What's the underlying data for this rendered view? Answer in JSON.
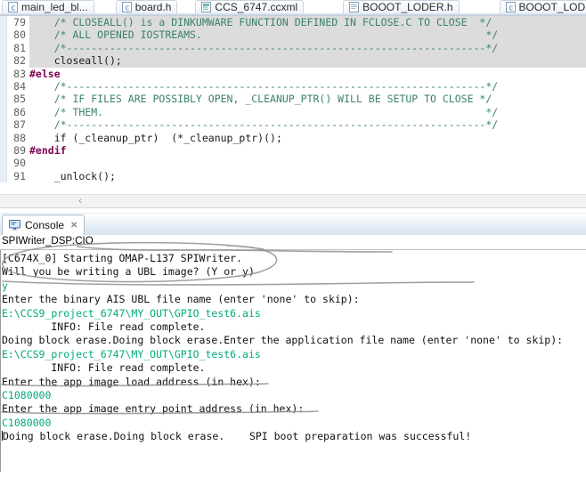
{
  "colors": {
    "comment_green": "#3C8269",
    "directive_maroon": "#7F0055",
    "console_input_green": "#00AA7D",
    "selection_gray": "#DCDCDC",
    "annotation_gray": "#8F8F8F"
  },
  "editor_tabs": [
    {
      "label": "main_led_bl...",
      "icon": "c-file-icon"
    },
    {
      "label": "board.h",
      "icon": "c-file-icon"
    },
    {
      "label": "CCS_6747.ccxml",
      "icon": "target-config-icon"
    },
    {
      "label": "BOOOT_LODER.h",
      "icon": "header-file-icon"
    },
    {
      "label": "BOOOT_LODER.c",
      "icon": "c-file-icon"
    }
  ],
  "icons": {
    "close": "✕",
    "scroll_left": "‹"
  },
  "editor": {
    "lines": [
      {
        "num": "79",
        "text": "    /* CLOSEALL() is a DINKUMWARE FUNCTION DEFINED IN FCLOSE.C TO CLOSE  */"
      },
      {
        "num": "80",
        "text": "    /* ALL OPENED IOSTREAMS.                                              */"
      },
      {
        "num": "81",
        "text": "    /*--------------------------------------------------------------------*/"
      },
      {
        "num": "82",
        "text": "    closeall();"
      },
      {
        "num": "83",
        "text": "#else"
      },
      {
        "num": "84",
        "text": "    /*--------------------------------------------------------------------*/"
      },
      {
        "num": "85",
        "text": "    /* IF FILES ARE POSSIBLY OPEN, _CLEANUP_PTR() WILL BE SETUP TO CLOSE */"
      },
      {
        "num": "86",
        "text": "    /* THEM.                                                              */"
      },
      {
        "num": "87",
        "text": "    /*--------------------------------------------------------------------*/"
      },
      {
        "num": "88",
        "text": "    if (_cleanup_ptr)  (*_cleanup_ptr)();"
      },
      {
        "num": "89",
        "text": "#endif"
      },
      {
        "num": "90",
        "text": ""
      },
      {
        "num": "91",
        "text": "    _unlock();"
      }
    ]
  },
  "console": {
    "tab_label": "Console",
    "title": "SPIWriter_DSP:CIO",
    "lines": [
      {
        "text": "[C674X_0] Starting OMAP-L137 SPIWriter."
      },
      {
        "text": "Will you be writing a UBL image? (Y or y)"
      },
      {
        "text": "y"
      },
      {
        "text": "Enter the binary AIS UBL file name (enter 'none' to skip):"
      },
      {
        "text": "E:\\CCS9_project_6747\\MY_OUT\\GPIO_test6.ais"
      },
      {
        "text": "        INFO: File read complete."
      },
      {
        "text": "Doing block erase.Doing block erase.Enter the application file name (enter 'none' to skip):"
      },
      {
        "text": "E:\\CCS9_project_6747\\MY_OUT\\GPIO_test6.ais"
      },
      {
        "text": "        INFO: File read complete."
      },
      {
        "text": "Enter the app image load address (in hex):"
      },
      {
        "text": "C1080000"
      },
      {
        "text": "Enter the app image entry point address (in hex):"
      },
      {
        "text": "C1080000"
      },
      {
        "text": "Doing block erase.Doing block erase.    SPI boot preparation was successful!"
      }
    ]
  }
}
